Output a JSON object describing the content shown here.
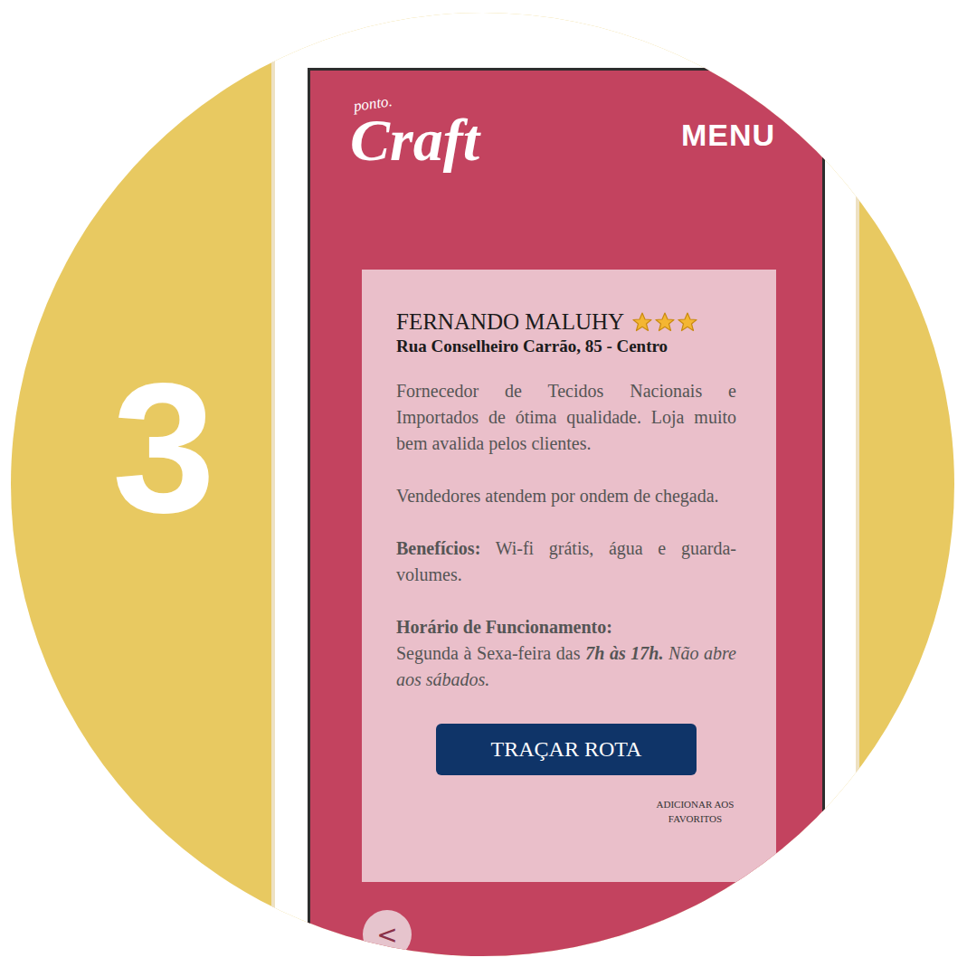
{
  "step": "3",
  "header": {
    "logo": {
      "prefix": "ponto.",
      "name": "Craft"
    },
    "menu": "MENU"
  },
  "store": {
    "name": "FERNANDO MALUHY",
    "stars": 3,
    "address": "Rua Conselheiro Carrão, 85 - Centro",
    "description": [
      "Fornecedor de Tecidos Nacionais e Importados de ótima qualidade. Loja muito bem avalida pelos clientes.",
      "Vendedores atendem por ondem de chegada."
    ],
    "benefits": {
      "label": "Benefícios:",
      "text": "Wi-fi grátis, água e guarda-volumes."
    },
    "hours": {
      "label": "Horário de Funcionamento:",
      "segments": [
        {
          "text": "Segunda à Sexa-feira das ",
          "kind": "plain"
        },
        {
          "text": "7h às 17h.",
          "kind": "strong"
        },
        {
          "text": " Não abre aos sábados.",
          "kind": "italic"
        }
      ]
    }
  },
  "actions": {
    "route": "TRAÇAR ROTA",
    "favorite": "ADICIONAR AOS FAVORITOS"
  },
  "back": "<"
}
